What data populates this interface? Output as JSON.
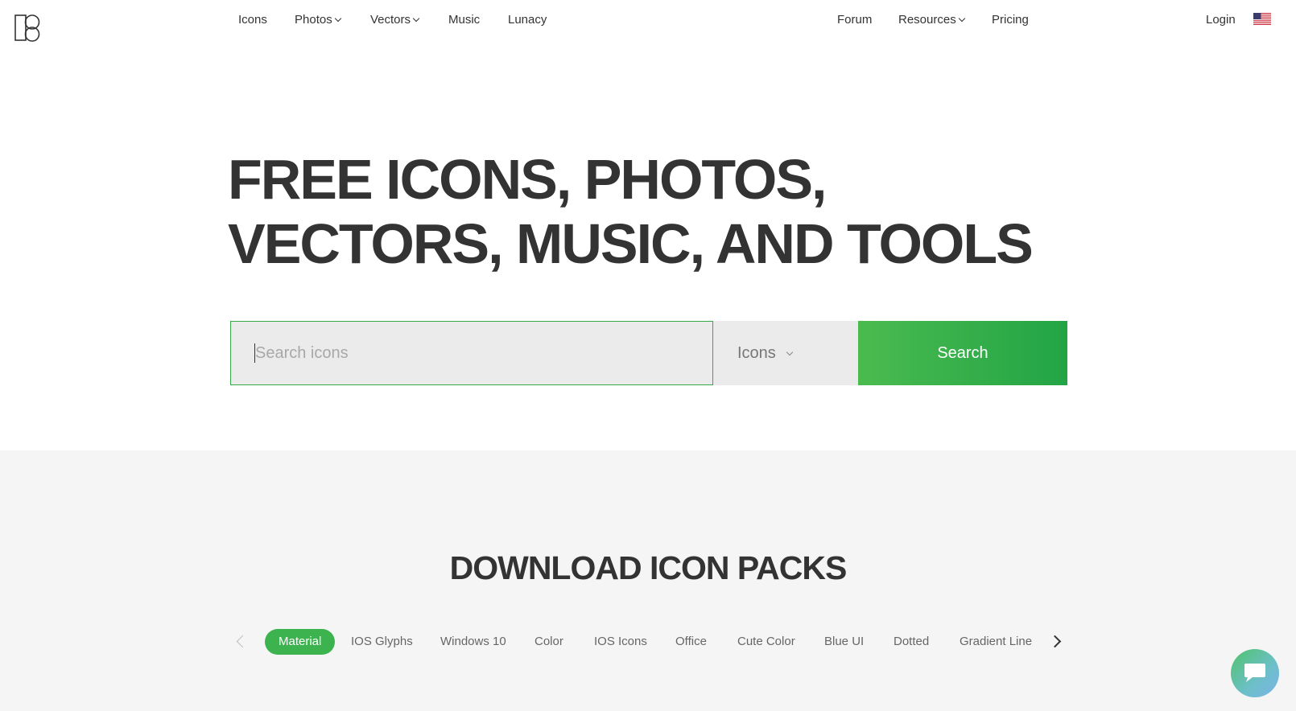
{
  "header": {
    "nav_left": [
      {
        "label": "Icons",
        "dropdown": false
      },
      {
        "label": "Photos",
        "dropdown": true
      },
      {
        "label": "Vectors",
        "dropdown": true
      },
      {
        "label": "Music",
        "dropdown": false
      },
      {
        "label": "Lunacy",
        "dropdown": false
      }
    ],
    "nav_right": [
      {
        "label": "Forum",
        "dropdown": false
      },
      {
        "label": "Resources",
        "dropdown": true
      },
      {
        "label": "Pricing",
        "dropdown": false
      }
    ],
    "login_label": "Login",
    "flag_icon": "us-flag-icon"
  },
  "hero": {
    "title": "FREE ICONS, PHOTOS,\nVECTORS, MUSIC, AND TOOLS",
    "search_placeholder": "Search icons",
    "search_value": "",
    "type_selected": "Icons",
    "search_button_label": "Search"
  },
  "packs": {
    "title": "DOWNLOAD ICON PACKS",
    "tabs": [
      "Material",
      "IOS Glyphs",
      "Windows 10",
      "Color",
      "IOS Icons",
      "Office",
      "Cute Color",
      "Blue UI",
      "Dotted",
      "Gradient Line"
    ],
    "active_tab": "Material"
  },
  "colors": {
    "accent_green": "#3cb34f",
    "text_dark": "#333333",
    "section_bg": "#f5f5f5"
  }
}
